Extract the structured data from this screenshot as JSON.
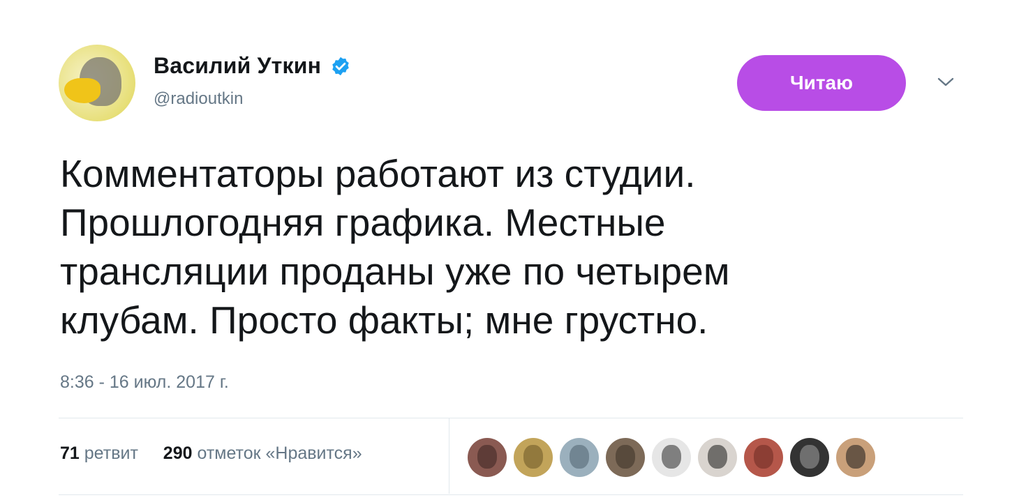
{
  "tweet": {
    "author": {
      "name": "Василий Уткин",
      "handle": "@radioutkin"
    },
    "follow_button_label": "Читаю",
    "text": "Комментаторы работают из студии.\nПрошлогодняя графика. Местные\nтрансляции проданы уже по четырем\nклубам. Просто факты; мне грустно.",
    "timestamp": "8:36 - 16 июл. 2017 г.",
    "stats": {
      "retweets_count": "71",
      "retweets_label": "ретвит",
      "likes_count": "290",
      "likes_label": "отметок «Нравится»"
    }
  },
  "colors": {
    "follow_button": "#b84de6",
    "verified_badge": "#1da1f2",
    "secondary_text": "#657786",
    "divider": "#e1e8ed"
  },
  "icons": {
    "verified": "verified-badge-icon",
    "more": "chevron-down-icon"
  },
  "likers": [
    {
      "bg": "#8a5a52",
      "fg": "#3a2520"
    },
    {
      "bg": "#c2a45a",
      "fg": "#6b5527"
    },
    {
      "bg": "#9bb0bd",
      "fg": "#4f6370"
    },
    {
      "bg": "#7d6a58",
      "fg": "#3a3026"
    },
    {
      "bg": "#e6e6e6",
      "fg": "#2a2a2a"
    },
    {
      "bg": "#d9d4cf",
      "fg": "#1a1a1a"
    },
    {
      "bg": "#b5574a",
      "fg": "#6a2a22"
    },
    {
      "bg": "#333333",
      "fg": "#a0a0a0"
    },
    {
      "bg": "#c9a07a",
      "fg": "#1a1a1a"
    }
  ]
}
